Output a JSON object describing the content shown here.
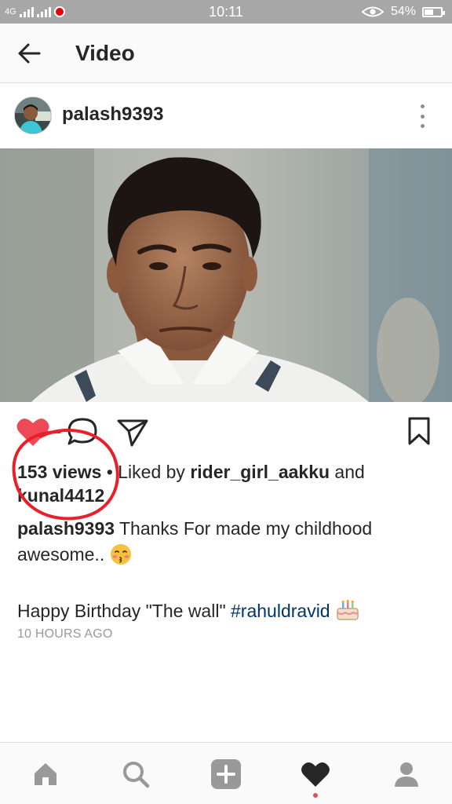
{
  "status_bar": {
    "network": "4G",
    "time": "10:11",
    "battery": "54%",
    "battery_level": 0.54
  },
  "header": {
    "back_icon": "back-arrow-icon",
    "title": "Video"
  },
  "post": {
    "username": "palash9393",
    "more_icon": "more-vertical-icon",
    "views": "153 views",
    "separator": " • ",
    "liked_by_prefix": "Liked by ",
    "liked_by_user": "rider_girl_aakku",
    "liked_and": " and",
    "liked_by_second": "kunal4412",
    "caption_user": "palash9393",
    "caption_text": " Thanks For made my childhood awesome.. ",
    "caption_line2": "Happy Birthday \"The wall\" ",
    "hashtag": "#rahuldravid",
    "timestamp": "10 HOURS AGO",
    "liked": true
  },
  "actions": {
    "like_icon": "heart-filled-icon",
    "comment_icon": "comment-icon",
    "share_icon": "send-icon",
    "save_icon": "bookmark-icon"
  },
  "bottom_nav": {
    "items": [
      "home-icon",
      "search-icon",
      "add-icon",
      "activity-heart-icon",
      "profile-icon"
    ],
    "active": "activity-heart-icon"
  },
  "colors": {
    "like_red": "#ed4956",
    "hashtag": "#003569",
    "annotation_red": "#e8202a",
    "status_bar": "#a7a7a7"
  }
}
